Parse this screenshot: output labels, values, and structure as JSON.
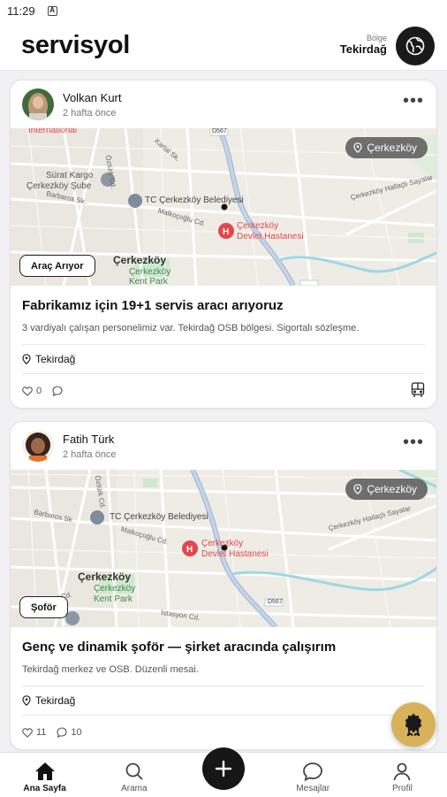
{
  "status_bar": {
    "time": "11:29",
    "indicator": "A"
  },
  "header": {
    "app_title": "servisyol",
    "region_label": "Bölge",
    "region_value": "Tekirdağ"
  },
  "posts": [
    {
      "user_name": "Volkan Kurt",
      "time_ago": "2 hafta önce",
      "location_pill": "Çerkezköy",
      "type_badge": "Araç Arıyor",
      "title": "Fabrikamız için 19+1 servis aracı arıyoruz",
      "description": "3 vardiyalı çalışan personelimiz var. Tekirdağ OSB bölgesi. Sigortalı sözleşme.",
      "location": "Tekirdağ",
      "likes": "0",
      "comments": "",
      "map_labels": {
        "international": "International",
        "cargo1": "Sürat Kargo",
        "cargo2": "Çerkezköy Şube",
        "belediye": "TC Çerkezköy Belediyesi",
        "hospital1": "Çerkezköy",
        "hospital2": "Devlet Hastanesi",
        "town": "Çerkezköy",
        "park1": "Çerkezköy",
        "park2": "Kent Park",
        "road": "Çerkezköy Hallaçlı Sayalar",
        "barbaros": "Barbaros Sk.",
        "malkoc": "Malkoçoğlu Cd.",
        "kartal": "Kartal Sk.",
        "d567": "D567",
        "ozturk": "Öztürk Cd."
      }
    },
    {
      "user_name": "Fatih Türk",
      "time_ago": "2 hafta önce",
      "location_pill": "Çerkezköy",
      "type_badge": "Şoför",
      "title": "Genç ve dinamik şoför — şirket aracında çalışırım",
      "description": "Tekirdağ merkez ve OSB. Düzenli mesai.",
      "location": "Tekirdağ",
      "likes": "11",
      "comments": "10",
      "map_labels": {
        "belediye": "TC Çerkezköy Belediyesi",
        "hospital1": "Çerkezköy",
        "hospital2": "Devlet Hastanesi",
        "town": "Çerkezköy",
        "park1": "Çerkezköy",
        "park2": "Kent Park",
        "road": "Çerkezköy Hallaçlı Sayalar",
        "barbaros": "Barbaros Sk.",
        "malkoc": "Malkoçoğlu Cd.",
        "batur": "Batur Cd.",
        "istasyon": "İstasyon Cd.",
        "d567": "D567",
        "ozturk": "Öztürk Cd."
      }
    }
  ],
  "nav": {
    "home": "Ana Sayfa",
    "search": "Arama",
    "messages": "Mesajlar",
    "profile": "Profil"
  },
  "colors": {
    "accent": "#161616",
    "award_fab": "#d8b25a",
    "hospital": "#e2474d",
    "pill": "#6e6e6e"
  },
  "icons": [
    "globe-icon",
    "more-icon",
    "pin-icon",
    "heart-icon",
    "comment-icon",
    "bus-icon",
    "award-icon",
    "home-icon",
    "search-icon",
    "plus-icon",
    "message-icon",
    "profile-icon"
  ]
}
